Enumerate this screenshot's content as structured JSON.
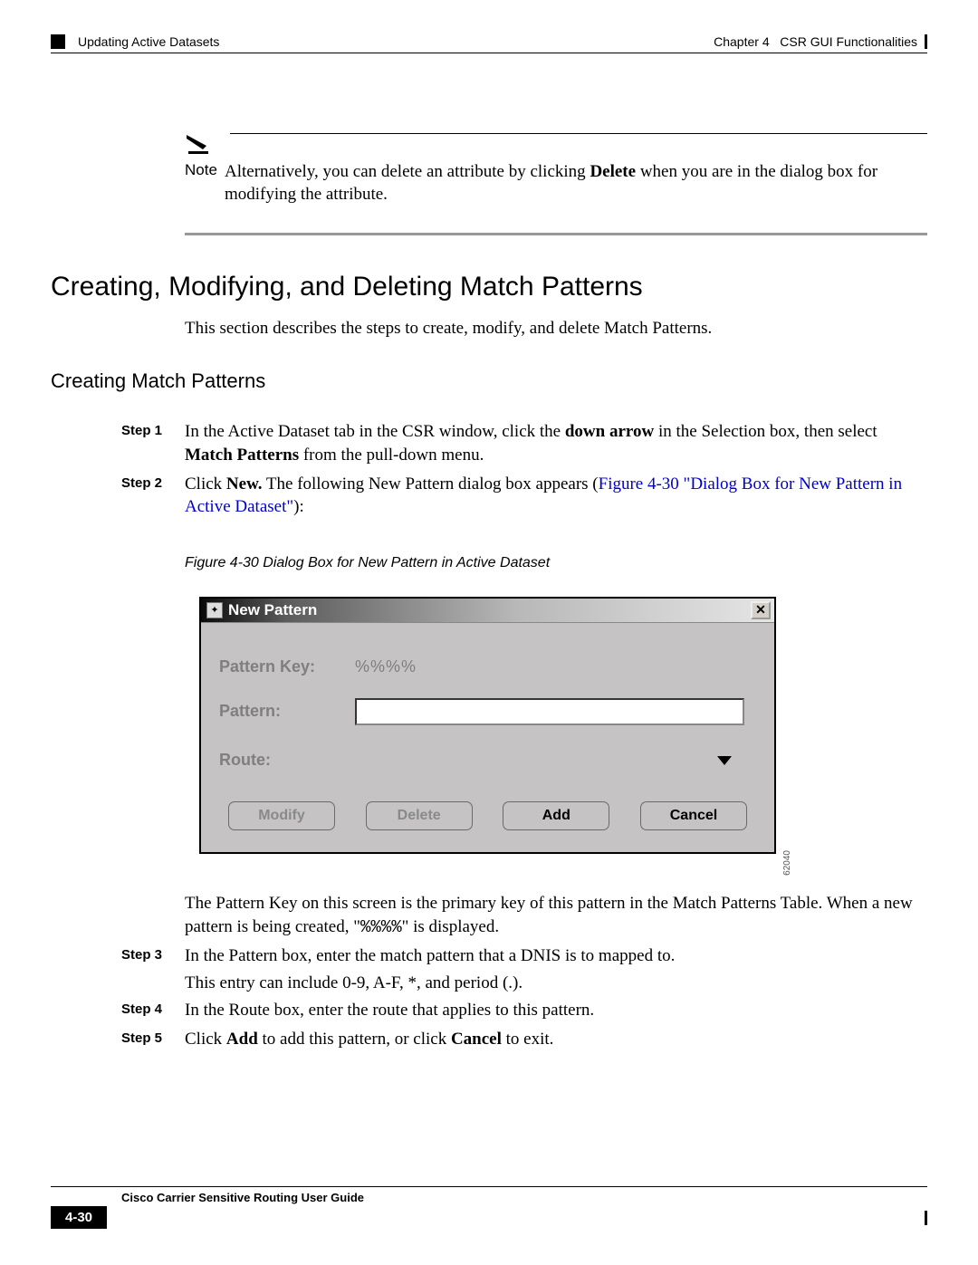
{
  "header": {
    "left_text": "Updating Active Datasets",
    "right_chapter": "Chapter 4",
    "right_title": "CSR GUI Functionalities"
  },
  "note": {
    "label": "Note",
    "text_prefix": "Alternatively, you can delete an attribute by clicking ",
    "bold_word": "Delete",
    "text_suffix": " when you are in the dialog box for modifying the attribute."
  },
  "h1": "Creating, Modifying, and Deleting Match Patterns",
  "intro": "This section describes the steps to create, modify, and delete Match Patterns.",
  "h2": "Creating Match Patterns",
  "steps": {
    "s1": {
      "label": "Step 1",
      "p1_a": "In the Active Dataset tab in the CSR window, click the ",
      "p1_b": "down arrow",
      "p1_c": " in the Selection box, then select ",
      "p1_d": "Match Patterns",
      "p1_e": " from the pull-down menu."
    },
    "s2": {
      "label": "Step 2",
      "p2_a": "Click ",
      "p2_b": "New.",
      "p2_c": " The following New Pattern dialog box appears (",
      "link": "Figure 4-30 \"Dialog Box for New Pattern in Active Dataset\"",
      "p2_d": "):"
    },
    "s3": {
      "label": "Step 3",
      "p3_a": "In the Pattern box, enter the match pattern that a DNIS is to mapped to.",
      "p3_b": "This entry can include 0-9, A-F, *, and period (.)."
    },
    "s4": {
      "label": "Step 4",
      "p4": "In the Route box, enter the route that applies to this pattern."
    },
    "s5": {
      "label": "Step 5",
      "p5_a": "Click ",
      "p5_b": "Add",
      "p5_c": " to add this pattern, or click ",
      "p5_d": "Cancel",
      "p5_e": " to exit."
    }
  },
  "figure_caption": "Figure 4-30   Dialog Box for New Pattern in Active Dataset",
  "dialog": {
    "title": "New Pattern",
    "pattern_key_label": "Pattern Key:",
    "pattern_key_value": "%%%%",
    "pattern_label": "Pattern:",
    "route_label": "Route:",
    "btn_modify": "Modify",
    "btn_delete": "Delete",
    "btn_add": "Add",
    "btn_cancel": "Cancel",
    "side_id": "62040"
  },
  "after_paragraph": {
    "a": "The Pattern Key on this screen is the primary key of this pattern in the Match Patterns Table. When a new pattern is being created, \"",
    "mono": "%%%%",
    "b": "\" is displayed."
  },
  "footer": {
    "title": "Cisco Carrier Sensitive Routing User Guide",
    "page_num": "4-30"
  }
}
